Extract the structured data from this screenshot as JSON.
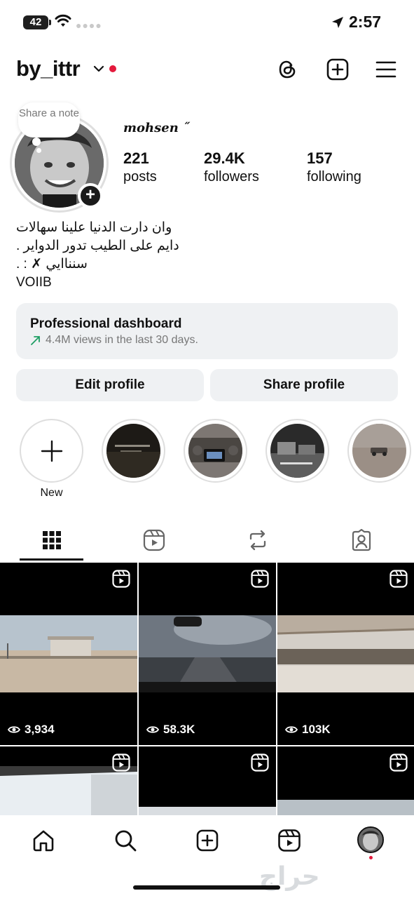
{
  "status_bar": {
    "battery": "42",
    "time": "2:57"
  },
  "header": {
    "username": "by_ittr"
  },
  "profile": {
    "note_text": "Share a note",
    "display_name": "mohsen ˝",
    "stats": [
      {
        "value": "221",
        "label": "posts"
      },
      {
        "value": "29.4K",
        "label": "followers"
      },
      {
        "value": "157",
        "label": "following"
      }
    ],
    "bio": [
      "وان دارت الدنيا علينا سهالات",
      "دايم على الطيب تدور الدواير .",
      "سنناايي ✗ : .",
      "VOIIB"
    ]
  },
  "dashboard": {
    "title": "Professional dashboard",
    "subtitle": "4.4M views in the last 30 days."
  },
  "buttons": {
    "edit": "Edit profile",
    "share": "Share profile"
  },
  "highlights": {
    "new_label": "New"
  },
  "grid": {
    "views": [
      "3,934",
      "58.3K",
      "103K"
    ]
  },
  "watermark": "حراج",
  "colors": {
    "accent_red": "#e41a3c",
    "trend_green": "#1d9e63",
    "panel_gray": "#eff1f3"
  }
}
